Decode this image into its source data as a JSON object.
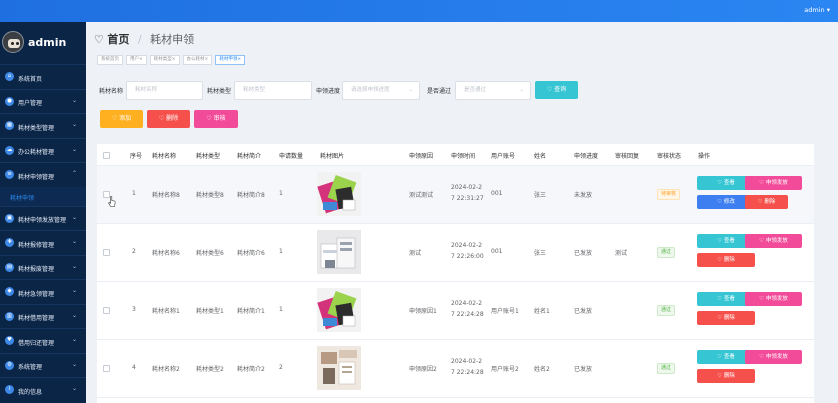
{
  "topbar": {
    "user": "admin ▾"
  },
  "sidebar": {
    "brand": "admin",
    "items": [
      {
        "label": "系统首页",
        "icon": "home-icon",
        "chevron": ""
      },
      {
        "label": "用户管理",
        "icon": "user-icon",
        "chevron": "⌄"
      },
      {
        "label": "耗材类型管理",
        "icon": "grid-icon",
        "chevron": "⌄"
      },
      {
        "label": "办公耗材管理",
        "icon": "cloud-icon",
        "chevron": "⌄"
      },
      {
        "label": "耗材申领管理",
        "icon": "list-icon",
        "chevron": "⌃"
      }
    ],
    "submenu": {
      "label": "耗材申领"
    },
    "items2": [
      {
        "label": "耗材申领发放管理",
        "icon": "box-icon",
        "chevron": "⌄"
      },
      {
        "label": "耗材报修管理",
        "icon": "tool-icon",
        "chevron": "⌄"
      },
      {
        "label": "耗材报废管理",
        "icon": "trash-icon",
        "chevron": "⌄"
      },
      {
        "label": "耗材急领管理",
        "icon": "bolt-icon",
        "chevron": "⌄"
      },
      {
        "label": "耗材借用管理",
        "icon": "chart-icon",
        "chevron": "⌄"
      },
      {
        "label": "借用归还管理",
        "icon": "return-icon",
        "chevron": "⌄"
      },
      {
        "label": "系统管理",
        "icon": "gear-icon",
        "chevron": "⌄"
      },
      {
        "label": "我的信息",
        "icon": "info-icon",
        "chevron": "⌄"
      }
    ]
  },
  "page": {
    "heart": "♡",
    "home": "首页",
    "separator": "/",
    "current": "耗材申领"
  },
  "tags": [
    "系统首页",
    "用户×",
    "耗材类型×",
    "办公耗材×",
    "耗材申领×"
  ],
  "search": {
    "name_label": "耗材名称",
    "name_placeholder": "耗材名称",
    "type_label": "耗材类型",
    "type_placeholder": "耗材类型",
    "progress_label": "申领进度",
    "progress_placeholder": "请选择申领进度",
    "passed_label": "是否通过",
    "passed_placeholder": "是否通过",
    "search_button": "♡ 查询"
  },
  "actions": {
    "add": "♡ 添加",
    "delete": "♡ 删除",
    "audit": "♡ 审核"
  },
  "table": {
    "headers": [
      "序号",
      "耗材名称",
      "耗材类型",
      "耗材简介",
      "申请数量",
      "耗材图片",
      "申领原因",
      "申领时间",
      "用户账号",
      "姓名",
      "申领进度",
      "审核回复",
      "审核状态",
      "操作"
    ],
    "rows": [
      {
        "no": "1",
        "name": "耗材名称8",
        "type": "耗材类型8",
        "intro": "耗材简介8",
        "qty": "1",
        "reason": "测试测试",
        "time1": "2024-02-2",
        "time2": "7 22:31:27",
        "account": "001",
        "person": "张三",
        "progress": "未发放",
        "reply": "",
        "status": "待审核",
        "status_kind": "warn",
        "view": "♡ 查看",
        "issue": "♡ 申领发放",
        "edit": "♡ 修改",
        "del": "♡ 删除"
      },
      {
        "no": "2",
        "name": "耗材名称6",
        "type": "耗材类型6",
        "intro": "耗材简介6",
        "qty": "1",
        "reason": "测试",
        "time1": "2024-02-2",
        "time2": "7 22:26:00",
        "account": "001",
        "person": "张三",
        "progress": "已发放",
        "reply": "测试",
        "status": "通过",
        "status_kind": "ok",
        "view": "♡ 查看",
        "issue": "♡ 申领发放",
        "del": "♡ 删除"
      },
      {
        "no": "3",
        "name": "耗材名称1",
        "type": "耗材类型1",
        "intro": "耗材简介1",
        "qty": "1",
        "reason": "申领原因1",
        "time1": "2024-02-2",
        "time2": "7 22:24:28",
        "account": "用户账号1",
        "person": "姓名1",
        "progress": "已发放",
        "reply": "",
        "status": "通过",
        "status_kind": "ok",
        "view": "♡ 查看",
        "issue": "♡ 申领发放",
        "del": "♡ 删除"
      },
      {
        "no": "4",
        "name": "耗材名称2",
        "type": "耗材类型2",
        "intro": "耗材简介2",
        "qty": "2",
        "reason": "申领原因2",
        "time1": "2024-02-2",
        "time2": "7 22:24:28",
        "account": "用户账号2",
        "person": "姓名2",
        "progress": "已发放",
        "reply": "",
        "status": "通过",
        "status_kind": "ok",
        "view": "♡ 查看",
        "issue": "♡ 申领发放",
        "del": "♡ 删除"
      }
    ]
  }
}
